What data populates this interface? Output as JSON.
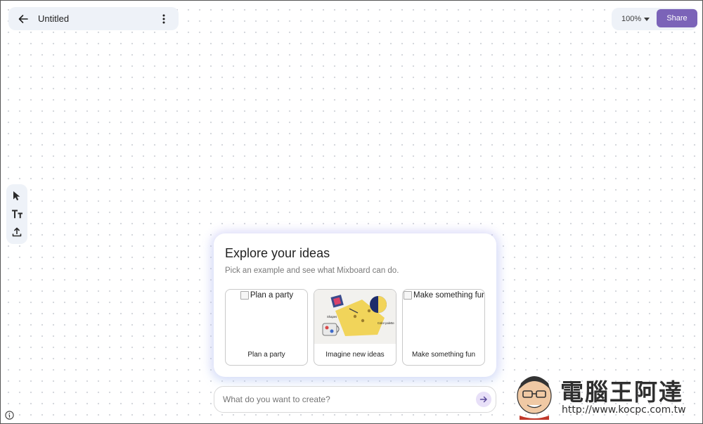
{
  "header": {
    "back_icon": "arrow-left-icon",
    "title": "Untitled",
    "more_icon": "more-vertical-icon"
  },
  "controls": {
    "zoom_label": "100%",
    "zoom_icon": "caret-down-icon",
    "share_label": "Share"
  },
  "toolbar": {
    "tools": [
      {
        "name": "select",
        "icon": "cursor-icon"
      },
      {
        "name": "text",
        "icon": "text-icon"
      },
      {
        "name": "upload",
        "icon": "upload-icon"
      }
    ]
  },
  "explore": {
    "title": "Explore your ideas",
    "subtitle": "Pick an example and see what Mixboard can do.",
    "examples": [
      {
        "alt": "Plan a party",
        "label": "Plan a party"
      },
      {
        "alt": "",
        "label": "Imagine new ideas",
        "collage_captions": [
          "Shapes",
          "Color palette"
        ]
      },
      {
        "alt": "Make something fun",
        "label": "Make something fun"
      }
    ]
  },
  "prompt": {
    "placeholder": "What do you want to create?",
    "send_icon": "arrow-right-icon"
  },
  "footer": {
    "info_icon": "info-icon"
  },
  "watermark": {
    "text": "電腦王阿達",
    "url": "http://www.kocpc.com.tw"
  },
  "colors": {
    "accent": "#7b63b8",
    "panel": "#eef2f8",
    "dots": "#d3d6db"
  }
}
